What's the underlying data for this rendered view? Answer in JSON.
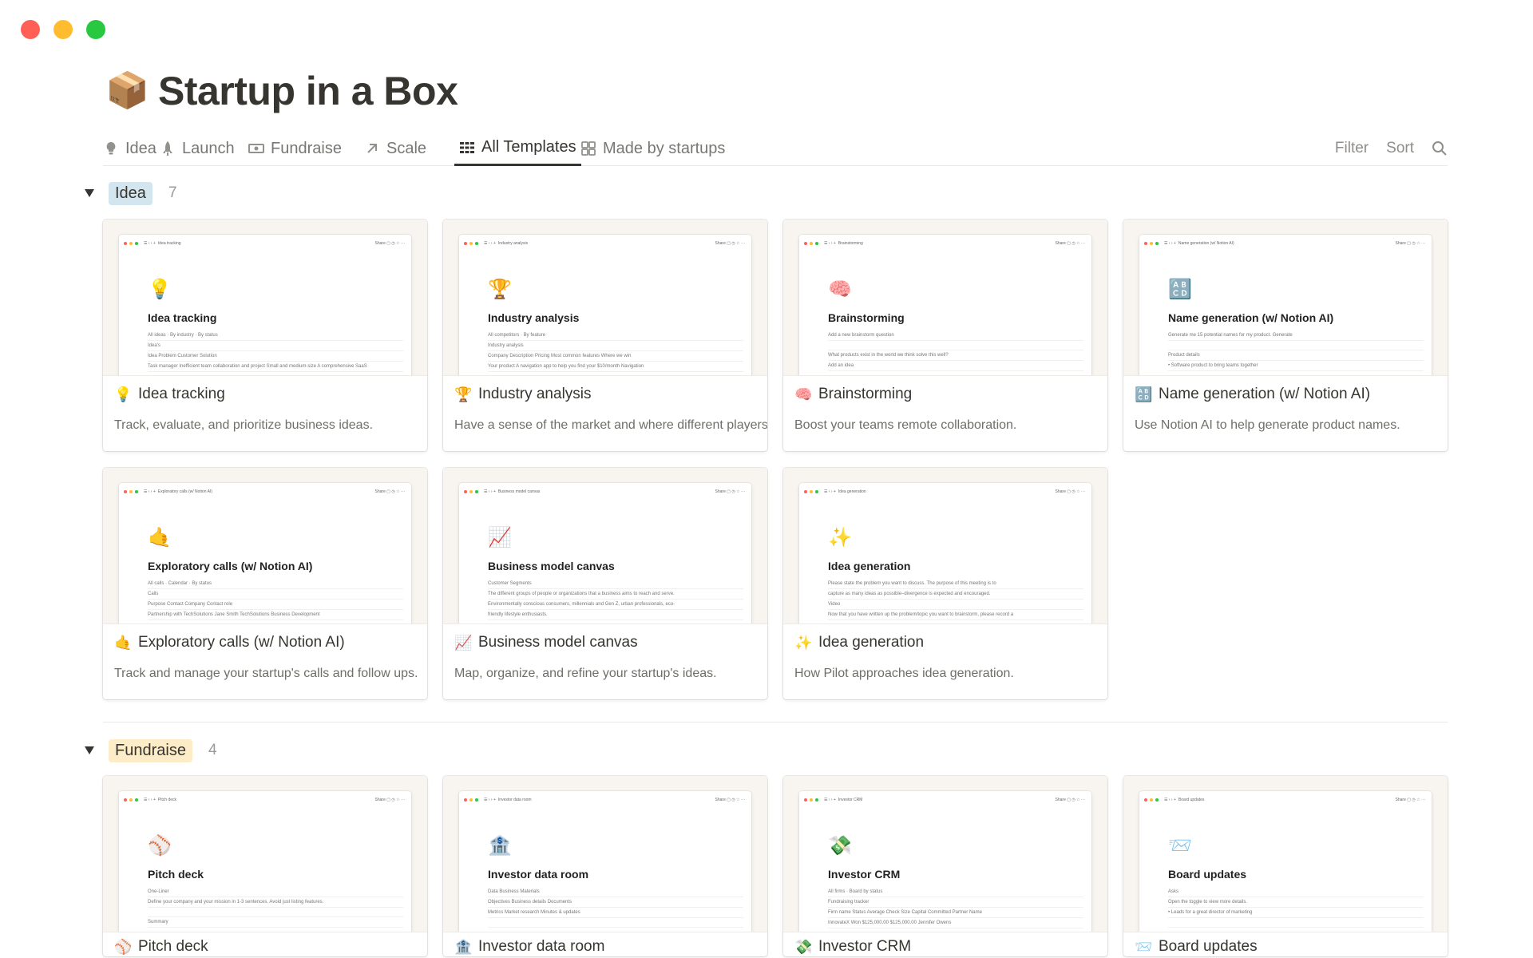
{
  "window": {
    "controls": [
      {
        "name": "close",
        "color": "#ff5f57"
      },
      {
        "name": "minimize",
        "color": "#febc2e"
      },
      {
        "name": "zoom",
        "color": "#28c840"
      }
    ]
  },
  "header": {
    "icon": "package-icon",
    "emoji": "📦",
    "title": "Startup in a Box"
  },
  "tabs": [
    {
      "label": "Idea",
      "icon": "lightbulb-icon"
    },
    {
      "label": "Launch",
      "icon": "rocket-icon"
    },
    {
      "label": "Fundraise",
      "icon": "money-icon"
    },
    {
      "label": "Scale",
      "icon": "arrow-up-right-icon"
    },
    {
      "label": "All Templates",
      "icon": "table-icon",
      "active": true
    },
    {
      "label": "Made by startups",
      "icon": "gallery-icon"
    }
  ],
  "tools": {
    "filter": "Filter",
    "sort": "Sort",
    "search_icon": "search-icon"
  },
  "groups": [
    {
      "label": "Idea",
      "count": "7",
      "color": "#d3e5ef",
      "cards": [
        {
          "emoji": "💡",
          "title": "Idea tracking",
          "desc": "Track, evaluate, and prioritize business ideas.",
          "preview": [
            "All ideas · By industry · By status",
            "Idea's",
            "Idea   Problem   Customer   Solution",
            "Task manager   Inefficient team collaboration and project   Small and medium-size   A comprehensive SaaS"
          ]
        },
        {
          "emoji": "🏆",
          "title": "Industry analysis",
          "desc": "Have a sense of the market and where different players stand.",
          "preview": [
            "All competitors · By feature",
            "Industry analysis",
            "Company   Description   Pricing   Most common features   Where we win",
            "Your product   A navigation app to help you find your   $10/month   Navigation"
          ]
        },
        {
          "emoji": "🧠",
          "title": "Brainstorming",
          "desc": "Boost your teams remote collaboration.",
          "preview": [
            "Add a new brainstorm question",
            "",
            "What products exist in the world we think solve this well?",
            "Add an idea"
          ]
        },
        {
          "emoji": "🔠",
          "title": "Name generation (w/ Notion AI)",
          "desc": "Use Notion AI to help generate product names.",
          "preview": [
            "Generate me 15 potential names for my product.   Generate",
            "",
            "Product details",
            "• Software product to bring teams together"
          ]
        },
        {
          "emoji": "🤙",
          "title": "Exploratory calls (w/ Notion AI)",
          "desc": "Track and manage your startup's calls and follow ups.",
          "preview": [
            "All calls · Calendar · By status",
            "Calls",
            "Purpose   Contact   Company   Contact role",
            "Partnership with TechSolutions   Jane Smith   TechSolutions   Business Development"
          ]
        },
        {
          "emoji": "📈",
          "title": "Business model canvas",
          "desc": "Map, organize, and refine your startup's ideas.",
          "preview": [
            "Customer Segments",
            "The different groups of people or organizations that a business aims to reach and serve.",
            "Environmentally conscious consumers, millennials and Gen Z, urban professionals, eco-",
            "friendly lifestyle enthusiasts."
          ]
        },
        {
          "emoji": "✨",
          "title": "Idea generation",
          "desc": "How Pilot approaches idea generation.",
          "preview": [
            "Please state the problem you want to discuss. The purpose of this meeting is to",
            "capture as many ideas as possible–divergence is expected and encouraged.",
            "Video",
            "Now that you have written up the problem/topic you want to brainstorm, please record a"
          ]
        }
      ]
    },
    {
      "label": "Fundraise",
      "count": "4",
      "color": "#fdecc8",
      "cards": [
        {
          "emoji": "⚾",
          "title": "Pitch deck",
          "preview": [
            "One-Liner",
            "Define your company and your mission in 1-3 sentences. Avoid just listing features.",
            "",
            "Summary"
          ]
        },
        {
          "emoji": "🏦",
          "title": "Investor data room",
          "preview": [
            "Data        Business        Materials",
            "Objectives   Business details   Documents",
            "Metrics   Market research   Minutes & updates",
            ""
          ]
        },
        {
          "emoji": "💸",
          "title": "Investor CRM",
          "preview": [
            "All firms · Board by status",
            "Fundraising tracker",
            "Firm name   Status   Average Check Size   Capital Committed   Partner Name",
            "InnovateX   Won   $125,000.00   $125,000.00   Jennifer Owens"
          ]
        },
        {
          "emoji": "📨",
          "title": "Board updates",
          "preview": [
            "Asks",
            "Open the toggle to view more details.",
            "• Leads for a great director of marketing",
            ""
          ]
        }
      ]
    }
  ]
}
